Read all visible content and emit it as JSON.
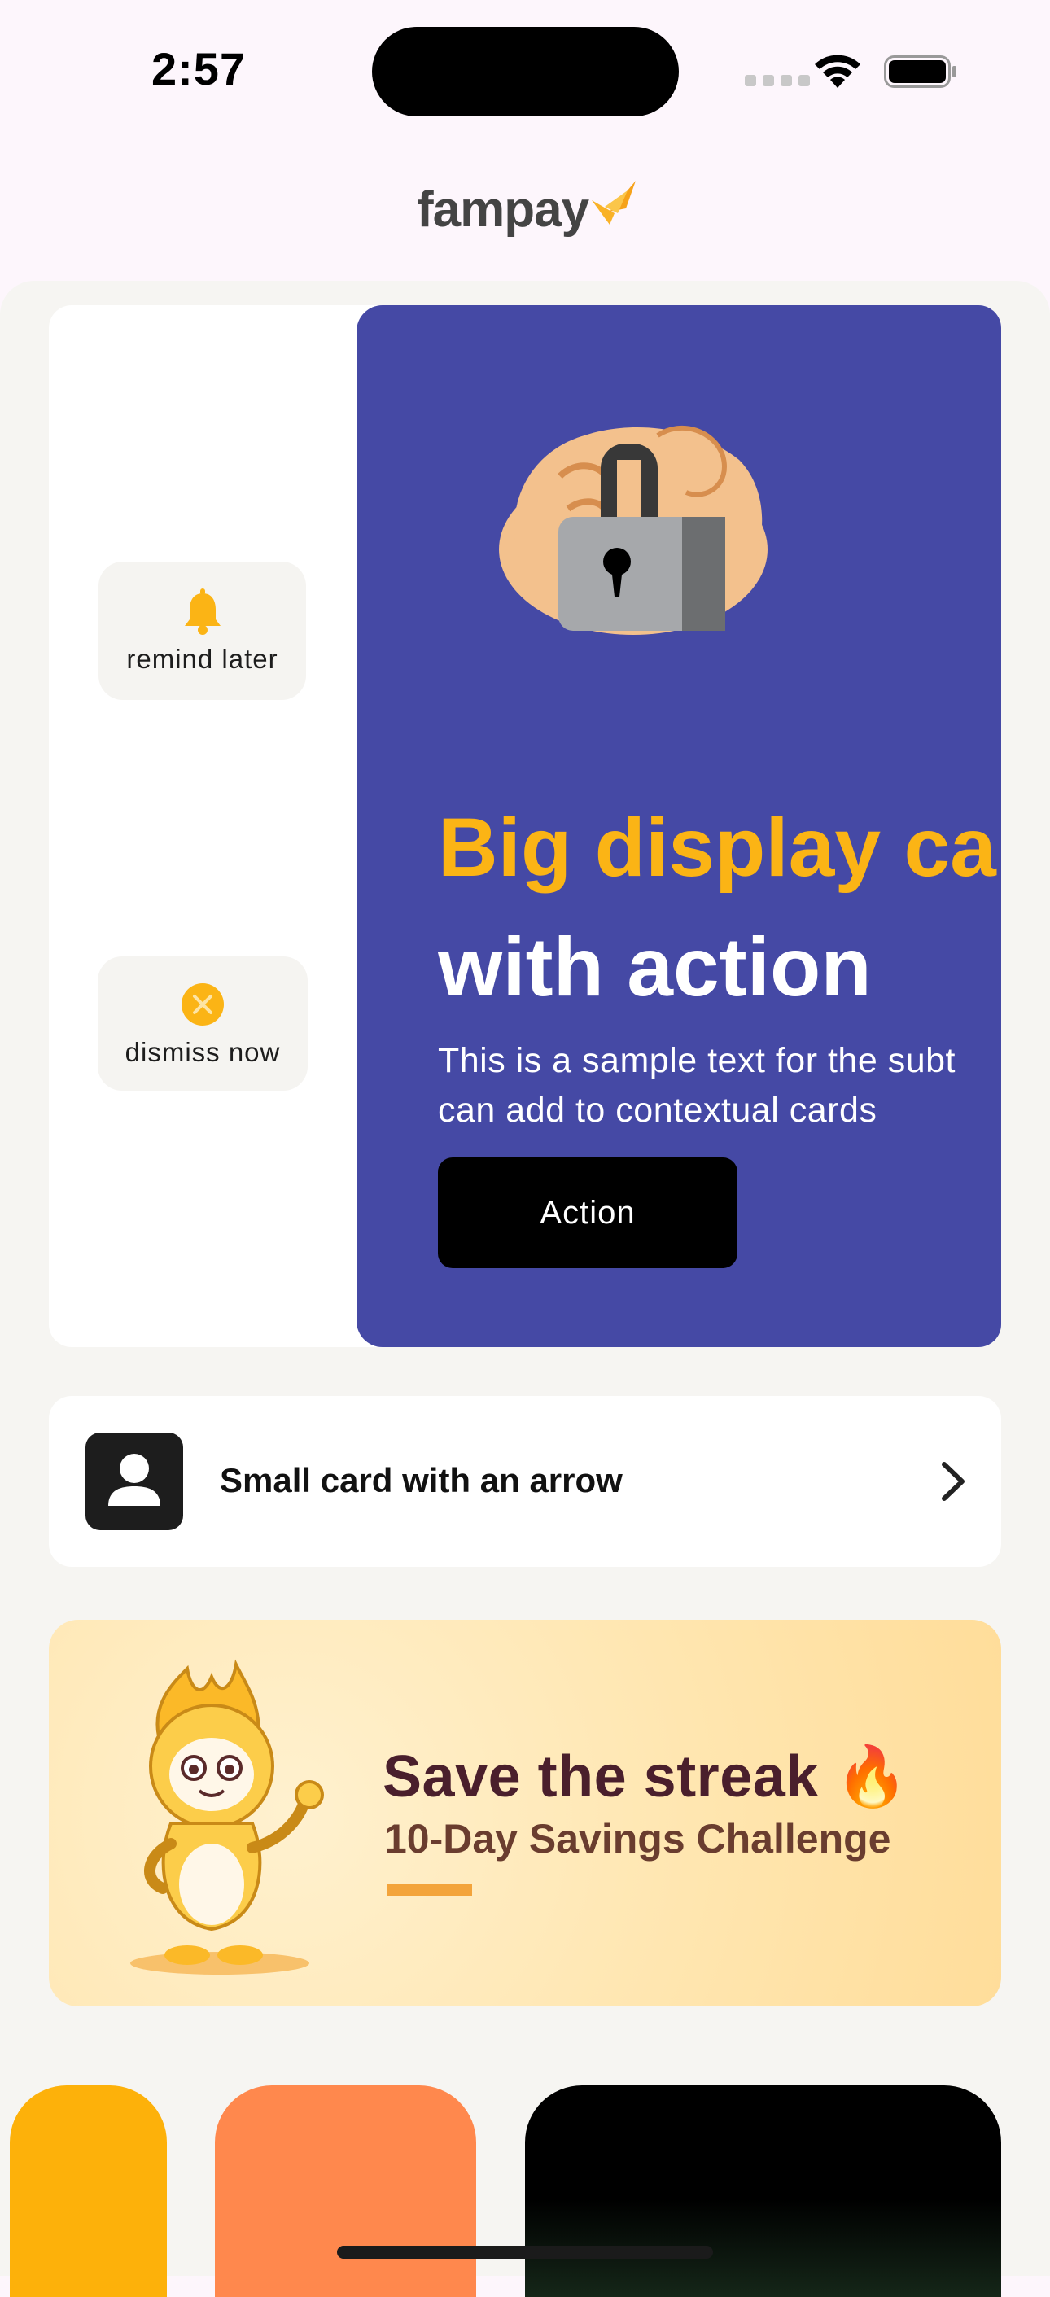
{
  "status_bar": {
    "time": "2:57"
  },
  "header": {
    "logo_text": "fampay",
    "logo_accent_color": "#f9b227"
  },
  "big_card": {
    "remind_label": "remind later",
    "dismiss_label": "dismiss now",
    "title_line1": "Big display car",
    "title_line2": "with action",
    "body": "This is a sample text for the subt\ncan add to contextual cards",
    "action_label": "Action",
    "background_color": "#4549a5",
    "title_accent_color": "#fbb415",
    "icon": "lock-in-hand-illustration"
  },
  "small_card": {
    "label": "Small card with an arrow",
    "icon": "user-icon",
    "arrow_icon": "chevron-right-icon"
  },
  "banner": {
    "title": "Save the streak 🔥",
    "subtitle": "10-Day Savings Challenge",
    "mascot": "flame-mascot-illustration"
  },
  "bottom_cards": {
    "colors": [
      "#fdb10a",
      "#ff884d",
      "#000000"
    ]
  }
}
